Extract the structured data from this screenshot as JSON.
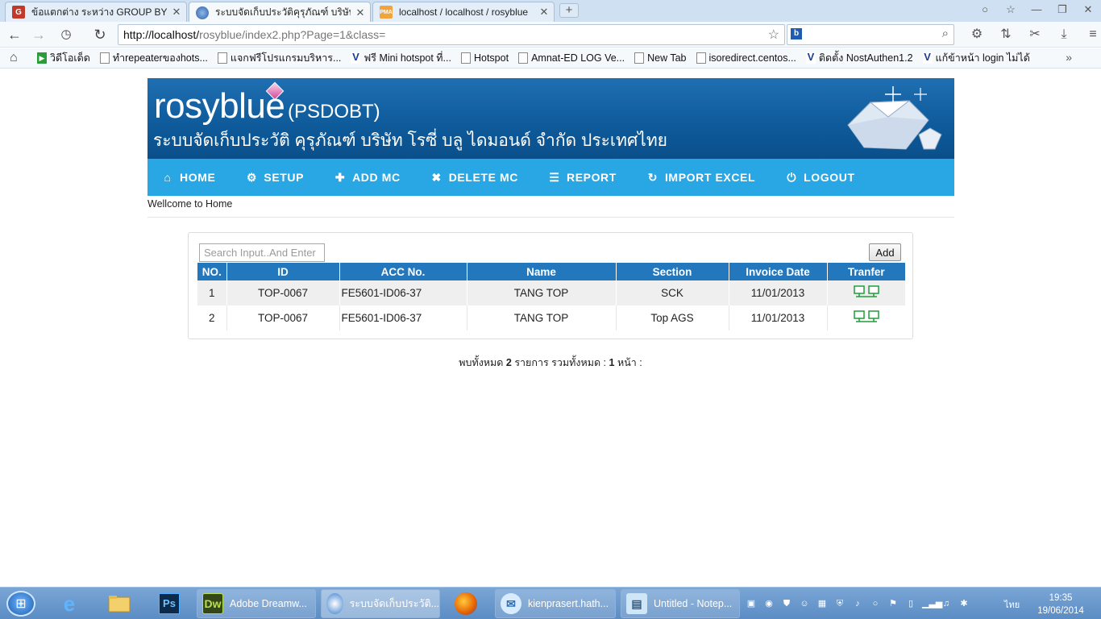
{
  "browser": {
    "tabs": [
      {
        "label": "ข้อแตกต่าง ระหว่าง GROUP BY และ DISTINCT",
        "active": false,
        "favicon": "G"
      },
      {
        "label": "ระบบจัดเก็บประวัติคุรุภัณฑ์ บริษัท โรซี่",
        "active": true,
        "favicon": "rosyblue"
      },
      {
        "label": "localhost / localhost / rosyblue",
        "active": false,
        "favicon": "PMA"
      }
    ],
    "url_host": "http://localhost/",
    "url_rest": "rosyblue/index2.php?Page=1&class=",
    "bookmarks": [
      "วิดีโอเด็ด",
      "ทำrepeaterของhots...",
      "แจกฟรีโปรแกรมบริหาร...",
      "ฟรี Mini hotspot ที่...",
      "Hotspot",
      "Amnat-ED LOG Ve...",
      "New Tab",
      "isoredirect.centos...",
      "ติดตั้ง NostAuthen1.2",
      "แก้ข้าหน้า login ไม่ได้"
    ]
  },
  "header": {
    "brand": "rosyblue",
    "brand_sub": "(PSDOBT)",
    "thai_title": "ระบบจัดเก็บประวัติ คุรุภัณฑ์ บริษัท โรซี่ บลู ไดมอนด์ จำกัด ประเทศไทย"
  },
  "nav": {
    "home": "HOME",
    "setup": "SETUP",
    "add_mc": "ADD MC",
    "delete_mc": "DELETE MC",
    "report": "REPORT",
    "import_excel": "IMPORT EXCEL",
    "logout": "LOGOUT"
  },
  "welcome": "Wellcome to Home",
  "search": {
    "placeholder": "Search Input..And Enter"
  },
  "add_label": "Add",
  "table": {
    "headers": [
      "NO.",
      "ID",
      "ACC No.",
      "Name",
      "Section",
      "Invoice Date",
      "Tranfer"
    ],
    "rows": [
      {
        "no": "1",
        "id": "TOP-0067",
        "acc": "FE5601-ID06-37",
        "name": "TANG TOP",
        "section": "SCK",
        "date": "11/01/2013"
      },
      {
        "no": "2",
        "id": "TOP-0067",
        "acc": "FE5601-ID06-37",
        "name": "TANG TOP",
        "section": "Top AGS",
        "date": "11/01/2013"
      }
    ]
  },
  "summary": {
    "prefix": "พบทั้งหมด",
    "total": "2",
    "mid": "รายการ รวมทั้งหมด :",
    "pages": "1",
    "suffix": "หน้า :"
  },
  "taskbar": {
    "tasks": [
      "Adobe Dreamw...",
      "ระบบจัดเก็บประวัติ...",
      "kienprasert.hath...",
      "Untitled - Notep..."
    ],
    "lang": "ไทย",
    "time": "19:35",
    "date": "19/06/2014"
  },
  "colors": {
    "banner": "#0e5a9a",
    "nav": "#29a6e4",
    "table_header": "#2377bd",
    "row_alt": "#efefef"
  }
}
